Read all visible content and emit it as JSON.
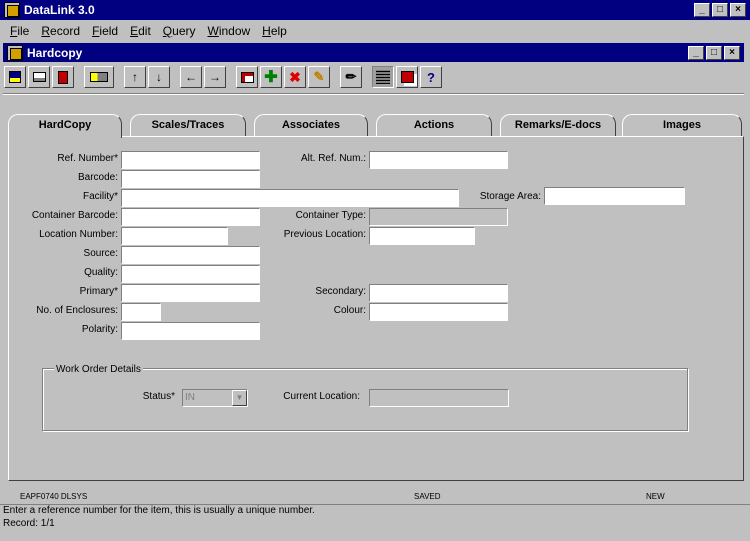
{
  "app": {
    "title": "DataLink 3.0"
  },
  "menu": [
    {
      "label": "File",
      "key": "F",
      "rest": "ile"
    },
    {
      "label": "Record",
      "key": "R",
      "rest": "ecord"
    },
    {
      "label": "Field",
      "key": "F",
      "rest": "ield"
    },
    {
      "label": "Edit",
      "key": "E",
      "rest": "dit"
    },
    {
      "label": "Query",
      "key": "Q",
      "rest": "uery"
    },
    {
      "label": "Window",
      "key": "W",
      "rest": "indow"
    },
    {
      "label": "Help",
      "key": "H",
      "rest": "elp"
    }
  ],
  "window": {
    "title": "Hardcopy"
  },
  "toolbar": {
    "buttons": [
      "save-icon",
      "print-icon",
      "exit-icon",
      "keys-icon",
      "up-arrow-icon",
      "down-arrow-icon",
      "left-arrow-icon",
      "right-arrow-icon",
      "image-icon",
      "add-icon",
      "delete-icon",
      "edit-icon",
      "pencil-icon",
      "grid-icon",
      "copy-icon",
      "help-icon"
    ],
    "arrow_up": "↑",
    "arrow_down": "↓",
    "arrow_left": "←",
    "arrow_right": "→",
    "help": "?"
  },
  "tabs": [
    "HardCopy",
    "Scales/Traces",
    "Associates",
    "Actions",
    "Remarks/E-docs",
    "Images"
  ],
  "form": {
    "ref_number": {
      "label": "Ref. Number*",
      "value": ""
    },
    "alt_ref_num": {
      "label": "Alt. Ref. Num.:",
      "value": ""
    },
    "barcode": {
      "label": "Barcode:",
      "value": ""
    },
    "facility": {
      "label": "Facility*",
      "value": ""
    },
    "storage_area": {
      "label": "Storage Area:",
      "value": ""
    },
    "container_barcode": {
      "label": "Container Barcode:",
      "value": ""
    },
    "container_type": {
      "label": "Container Type:",
      "value": ""
    },
    "location_number": {
      "label": "Location Number:",
      "value": ""
    },
    "previous_location": {
      "label": "Previous Location:",
      "value": ""
    },
    "source": {
      "label": "Source:",
      "value": ""
    },
    "quality": {
      "label": "Quality:",
      "value": ""
    },
    "primary": {
      "label": "Primary*",
      "value": ""
    },
    "secondary": {
      "label": "Secondary:",
      "value": ""
    },
    "no_enclosures": {
      "label": "No. of Enclosures:",
      "value": ""
    },
    "colour": {
      "label": "Colour:",
      "value": ""
    },
    "polarity": {
      "label": "Polarity:",
      "value": ""
    }
  },
  "work_order": {
    "title": "Work Order Details",
    "status_label": "Status*",
    "status_value": "IN",
    "current_location_label": "Current Location:",
    "current_location_value": ""
  },
  "status_bar": {
    "form_id": "EAPF0740 DLSYS",
    "state": "SAVED",
    "mode": "NEW",
    "hint": "Enter a reference number for the item, this is usually a unique number.",
    "record": "Record: 1/1"
  }
}
